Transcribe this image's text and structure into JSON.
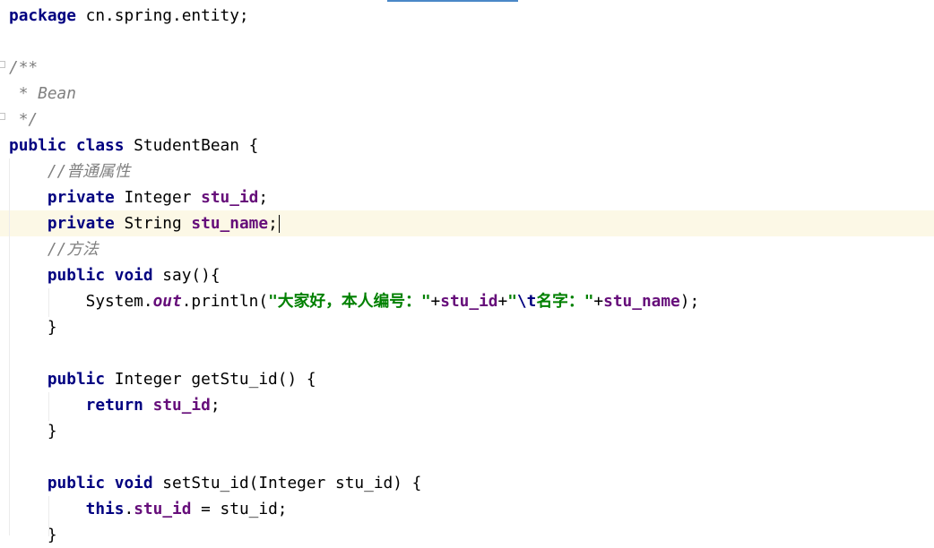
{
  "editor": {
    "caret_line": 8,
    "lines": [
      {
        "tokens": [
          {
            "t": "package",
            "c": "kw"
          },
          {
            "t": " cn.spring.entity;",
            "c": "plain"
          }
        ]
      },
      {
        "tokens": []
      },
      {
        "tokens": [
          {
            "t": "/**",
            "c": "comment"
          }
        ]
      },
      {
        "tokens": [
          {
            "t": " * Bean",
            "c": "comment"
          }
        ]
      },
      {
        "tokens": [
          {
            "t": " */",
            "c": "comment"
          }
        ]
      },
      {
        "tokens": [
          {
            "t": "public class",
            "c": "kw"
          },
          {
            "t": " StudentBean {",
            "c": "plain"
          }
        ]
      },
      {
        "tokens": [
          {
            "t": "    ",
            "c": "plain"
          },
          {
            "t": "//普通属性",
            "c": "comment"
          }
        ]
      },
      {
        "tokens": [
          {
            "t": "    ",
            "c": "plain"
          },
          {
            "t": "private",
            "c": "kw"
          },
          {
            "t": " Integer ",
            "c": "plain"
          },
          {
            "t": "stu_id",
            "c": "field"
          },
          {
            "t": ";",
            "c": "plain"
          }
        ]
      },
      {
        "tokens": [
          {
            "t": "    ",
            "c": "plain"
          },
          {
            "t": "private",
            "c": "kw"
          },
          {
            "t": " String ",
            "c": "plain"
          },
          {
            "t": "stu_name",
            "c": "field"
          },
          {
            "t": ";",
            "c": "plain"
          }
        ]
      },
      {
        "tokens": [
          {
            "t": "    ",
            "c": "plain"
          },
          {
            "t": "//方法",
            "c": "comment"
          }
        ]
      },
      {
        "tokens": [
          {
            "t": "    ",
            "c": "plain"
          },
          {
            "t": "public void",
            "c": "kw"
          },
          {
            "t": " say(){",
            "c": "plain"
          }
        ]
      },
      {
        "tokens": [
          {
            "t": "        System.",
            "c": "plain"
          },
          {
            "t": "out",
            "c": "static-field"
          },
          {
            "t": ".println(",
            "c": "plain"
          },
          {
            "t": "\"大家好，本人编号：\"",
            "c": "str"
          },
          {
            "t": "+",
            "c": "plain"
          },
          {
            "t": "stu_id",
            "c": "field"
          },
          {
            "t": "+",
            "c": "plain"
          },
          {
            "t": "\"",
            "c": "str"
          },
          {
            "t": "\\t",
            "c": "esc"
          },
          {
            "t": "名字：\"",
            "c": "str"
          },
          {
            "t": "+",
            "c": "plain"
          },
          {
            "t": "stu_name",
            "c": "field"
          },
          {
            "t": ");",
            "c": "plain"
          }
        ]
      },
      {
        "tokens": [
          {
            "t": "    }",
            "c": "plain"
          }
        ]
      },
      {
        "tokens": []
      },
      {
        "tokens": [
          {
            "t": "    ",
            "c": "plain"
          },
          {
            "t": "public",
            "c": "kw"
          },
          {
            "t": " Integer getStu_id() {",
            "c": "plain"
          }
        ]
      },
      {
        "tokens": [
          {
            "t": "        ",
            "c": "plain"
          },
          {
            "t": "return",
            "c": "kw"
          },
          {
            "t": " ",
            "c": "plain"
          },
          {
            "t": "stu_id",
            "c": "field"
          },
          {
            "t": ";",
            "c": "plain"
          }
        ]
      },
      {
        "tokens": [
          {
            "t": "    }",
            "c": "plain"
          }
        ]
      },
      {
        "tokens": []
      },
      {
        "tokens": [
          {
            "t": "    ",
            "c": "plain"
          },
          {
            "t": "public void",
            "c": "kw"
          },
          {
            "t": " setStu_id(Integer stu_id) {",
            "c": "plain"
          }
        ]
      },
      {
        "tokens": [
          {
            "t": "        ",
            "c": "plain"
          },
          {
            "t": "this",
            "c": "kw"
          },
          {
            "t": ".",
            "c": "plain"
          },
          {
            "t": "stu_id",
            "c": "field"
          },
          {
            "t": " = stu_id;",
            "c": "plain"
          }
        ]
      },
      {
        "tokens": [
          {
            "t": "    }",
            "c": "plain"
          }
        ]
      }
    ]
  }
}
